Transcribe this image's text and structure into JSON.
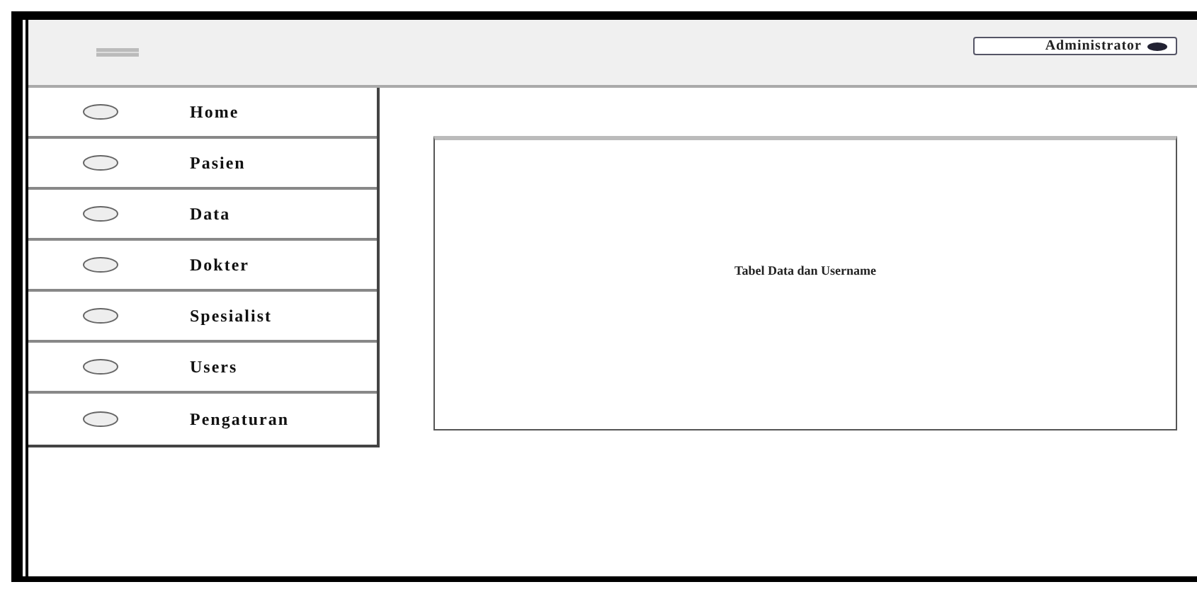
{
  "header": {
    "user_button": "Administrator"
  },
  "menu": [
    {
      "label": "Home"
    },
    {
      "label": "Pasien"
    },
    {
      "label": "Data"
    },
    {
      "label": "Dokter"
    },
    {
      "label": "Spesialist"
    },
    {
      "label": "Users"
    },
    {
      "label": "Pengaturan"
    }
  ],
  "content": {
    "placeholder_text": "Tabel Data dan Username"
  }
}
